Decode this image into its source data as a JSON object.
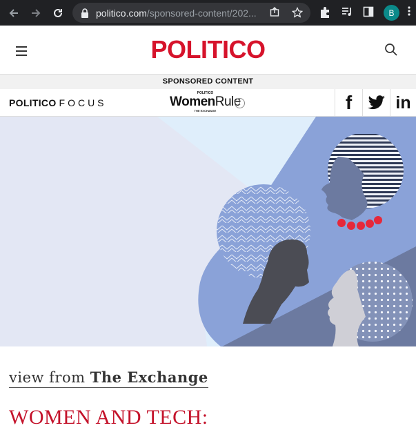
{
  "browser": {
    "url_host": "politico.com",
    "url_path": "/sponsored-content/202...",
    "avatar_letter": "B"
  },
  "site": {
    "logo": "POLITICO",
    "sponsored_label": "SPONSORED CONTENT"
  },
  "focus_bar": {
    "brand_bold": "POLITICO",
    "brand_light": "FOCUS",
    "womenrule_top": "POLITICO",
    "womenrule_women": "Women",
    "womenrule_rule": "Rule",
    "womenrule_sub": "THE EXCHANGE",
    "info_glyph": "i",
    "social": [
      "facebook",
      "twitter",
      "linkedin"
    ],
    "facebook_glyph": "f",
    "linkedin_glyph": "in"
  },
  "article": {
    "byline_light": "view from ",
    "byline_bold": "The Exchange",
    "headline": "WOMEN AND TECH:"
  },
  "colors": {
    "brand_red": "#d6132b",
    "chrome_bg": "#202124",
    "hero_light": "#e3e7f4",
    "hero_blue": "#8aa2d8",
    "hero_slate": "#6c7aa0"
  }
}
